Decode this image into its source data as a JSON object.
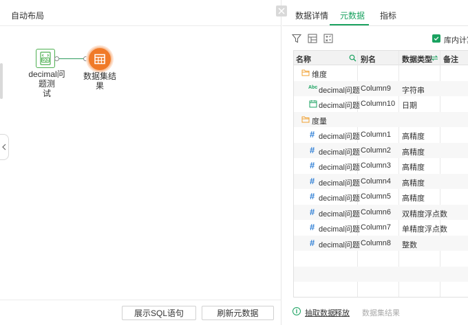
{
  "left": {
    "title": "自动布局",
    "nodes": {
      "sql_label": "decimal问题测试",
      "sql_label_line1": "decimal问题测",
      "sql_label_line2": "试",
      "result_label": "数据集结果",
      "sql_icon_text": "SQL"
    },
    "buttons": {
      "show_sql": "展示SQL语句",
      "refresh_meta": "刷新元数据"
    }
  },
  "right": {
    "tabs": [
      {
        "label": "数据详情",
        "active": false
      },
      {
        "label": "元数据",
        "active": true
      },
      {
        "label": "指标",
        "active": false
      }
    ],
    "checkbox_label": "库内计算",
    "columns": {
      "name": "名称",
      "alias": "别名",
      "type": "数据类型",
      "note": "备注"
    },
    "groups": {
      "dimension": "维度",
      "measure": "度量"
    },
    "dimension_rows": [
      {
        "icon": "Abc",
        "name": "decimal问题测",
        "alias": "Column9",
        "type": "字符串"
      },
      {
        "icon": "calendar",
        "name": "decimal问题测",
        "alias": "Column10",
        "type": "日期"
      }
    ],
    "measure_rows": [
      {
        "icon": "#",
        "name": "decimal问题测",
        "alias": "Column1",
        "type": "高精度"
      },
      {
        "icon": "#",
        "name": "decimal问题测",
        "alias": "Column2",
        "type": "高精度"
      },
      {
        "icon": "#",
        "name": "decimal问题测",
        "alias": "Column3",
        "type": "高精度"
      },
      {
        "icon": "#",
        "name": "decimal问题测",
        "alias": "Column4",
        "type": "高精度"
      },
      {
        "icon": "#",
        "name": "decimal问题测",
        "alias": "Column5",
        "type": "高精度"
      },
      {
        "icon": "#",
        "name": "decimal问题测",
        "alias": "Column6",
        "type": "双精度浮点数"
      },
      {
        "icon": "#",
        "name": "decimal问题测",
        "alias": "Column7",
        "type": "单精度浮点数"
      },
      {
        "icon": "#",
        "name": "decimal问题测",
        "alias": "Column8",
        "type": "整数"
      }
    ],
    "footer": {
      "info_icon": "i",
      "extract_link": "抽取数据",
      "release_link": "释放",
      "dataset_text": "数据集结果"
    }
  },
  "colors": {
    "accent": "#1aa260",
    "result_node": "#f07a28",
    "hash_icon": "#2f7fd6",
    "folder_icon": "#f0a030"
  }
}
